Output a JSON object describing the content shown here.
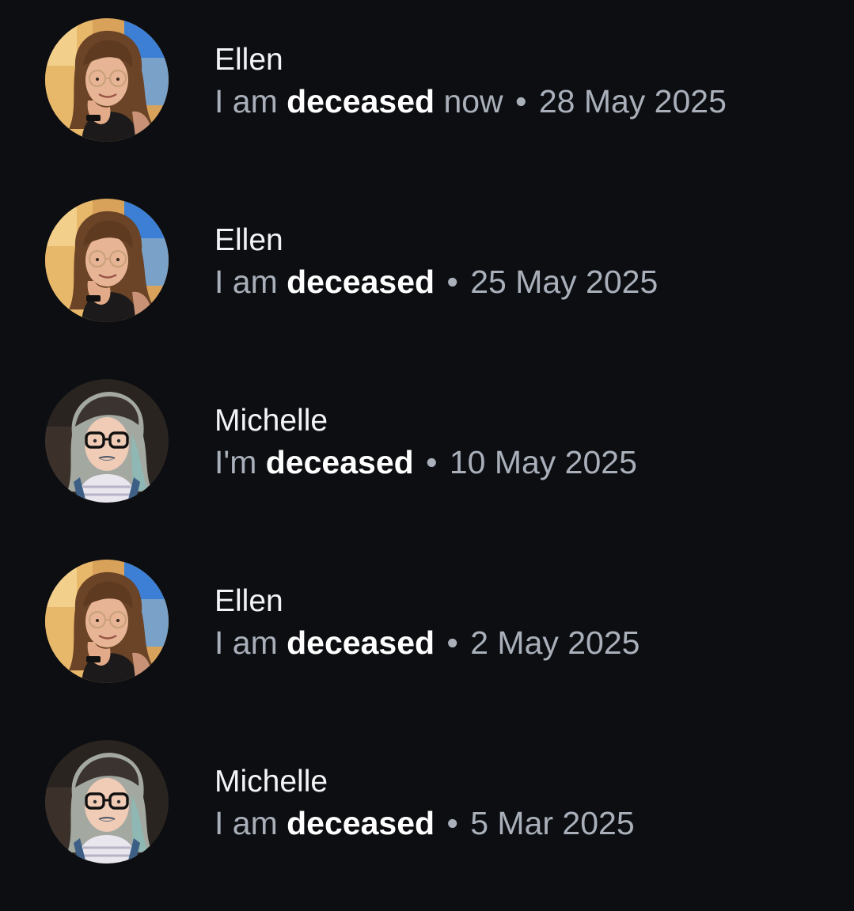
{
  "entries": [
    {
      "avatar": "ellen-avatar",
      "name": "Ellen",
      "prefix": "I am ",
      "keyword": "deceased",
      "suffix": " now",
      "separator": "•",
      "date": "28 May 2025"
    },
    {
      "avatar": "ellen-avatar",
      "name": "Ellen",
      "prefix": "I am ",
      "keyword": "deceased",
      "suffix": "",
      "separator": "•",
      "date": "25 May 2025"
    },
    {
      "avatar": "michelle-avatar",
      "name": "Michelle",
      "prefix": "I'm ",
      "keyword": "deceased",
      "suffix": "",
      "separator": "•",
      "date": "10 May 2025"
    },
    {
      "avatar": "ellen-avatar",
      "name": "Ellen",
      "prefix": "I am ",
      "keyword": "deceased",
      "suffix": "",
      "separator": "•",
      "date": "2 May 2025"
    },
    {
      "avatar": "michelle-avatar",
      "name": "Michelle",
      "prefix": "I am ",
      "keyword": "deceased",
      "suffix": "",
      "separator": "•",
      "date": "5 Mar 2025"
    }
  ],
  "colors": {
    "background": "#0c0e12",
    "name": "#f3f4f6",
    "muted_text": "#a9b0ba",
    "emphasis": "#ffffff"
  }
}
